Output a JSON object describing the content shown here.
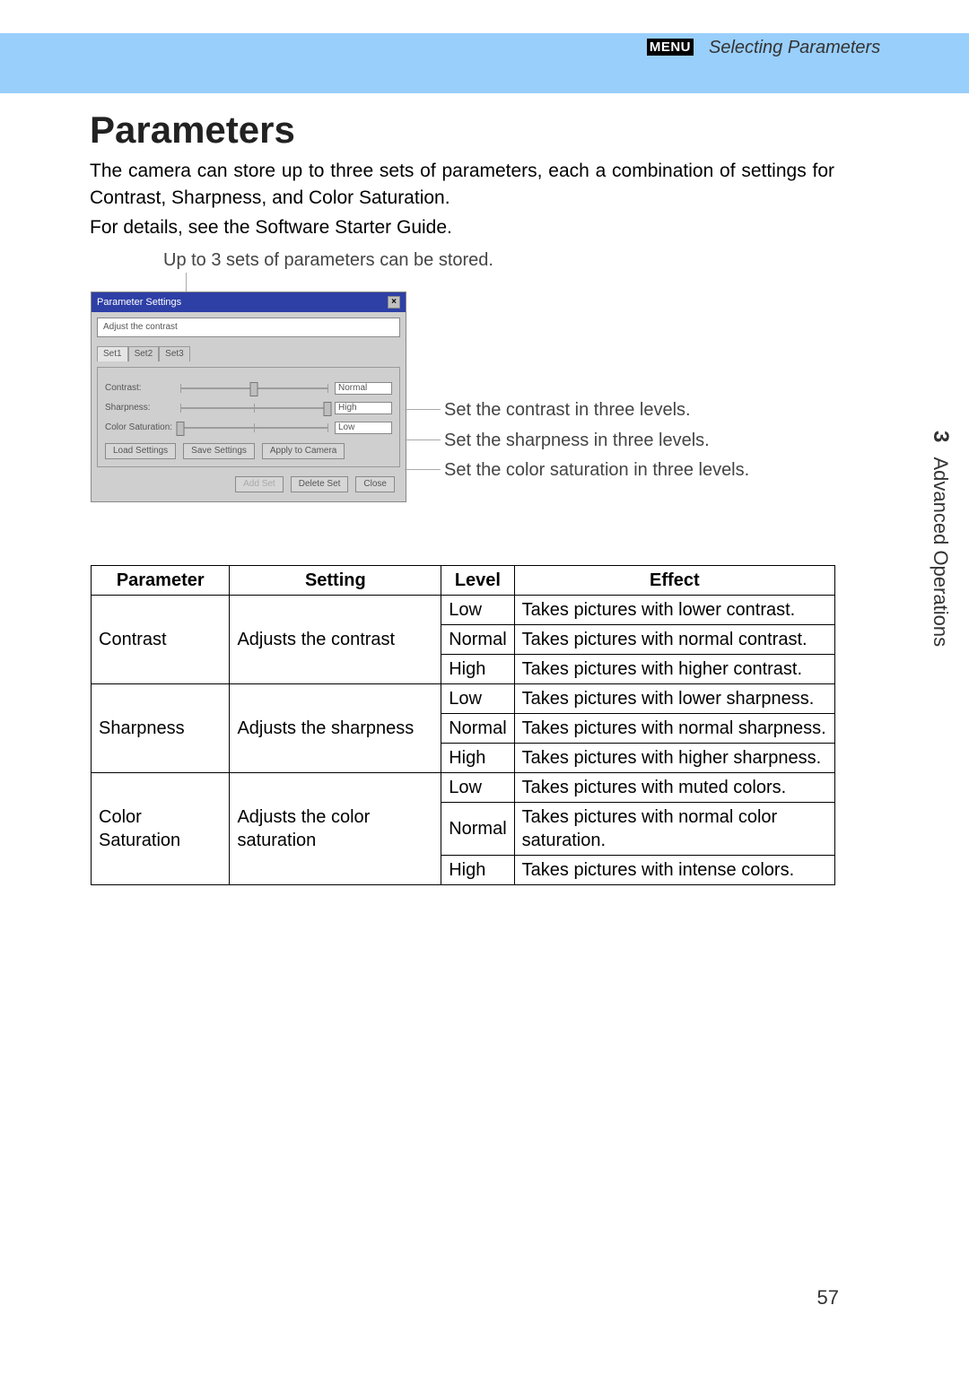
{
  "header": {
    "menu_badge": "MENU",
    "section": "Selecting Parameters"
  },
  "title": "Parameters",
  "intro1": "The camera can store up to three sets of parameters, each a combination of settings for Contrast, Sharpness, and Color Saturation.",
  "intro2": "For details, see the Software Starter Guide.",
  "caption_top": "Up to 3 sets of parameters can be stored.",
  "dialog": {
    "title": "Parameter Settings",
    "tip": "Adjust the contrast",
    "tabs": [
      "Set1",
      "Set2",
      "Set3"
    ],
    "rows": [
      {
        "label": "Contrast:",
        "value": "Normal",
        "pos": 50
      },
      {
        "label": "Sharpness:",
        "value": "High",
        "pos": 100
      },
      {
        "label": "Color Saturation:",
        "value": "Low",
        "pos": 0
      }
    ],
    "buttons_top": [
      "Load Settings",
      "Save Settings",
      "Apply to Camera"
    ],
    "buttons_bottom": [
      "Add Set",
      "Delete Set",
      "Close"
    ]
  },
  "callouts": {
    "contrast": "Set the contrast in three levels.",
    "sharpness": "Set the sharpness in three levels.",
    "saturation": "Set the color saturation in three levels."
  },
  "table": {
    "headers": [
      "Parameter",
      "Setting",
      "Level",
      "Effect"
    ],
    "groups": [
      {
        "param": "Contrast",
        "setting": "Adjusts the contrast",
        "rows": [
          {
            "level": "Low",
            "effect": "Takes pictures with lower contrast."
          },
          {
            "level": "Normal",
            "effect": "Takes pictures with normal contrast."
          },
          {
            "level": "High",
            "effect": "Takes pictures with higher contrast."
          }
        ]
      },
      {
        "param": "Sharpness",
        "setting": "Adjusts the sharpness",
        "rows": [
          {
            "level": "Low",
            "effect": "Takes pictures with lower sharpness."
          },
          {
            "level": "Normal",
            "effect": "Takes pictures with normal sharpness."
          },
          {
            "level": "High",
            "effect": "Takes pictures with higher sharpness."
          }
        ]
      },
      {
        "param": "Color Saturation",
        "setting": "Adjusts the color saturation",
        "rows": [
          {
            "level": "Low",
            "effect": "Takes pictures with muted colors."
          },
          {
            "level": "Normal",
            "effect": "Takes pictures with normal color saturation."
          },
          {
            "level": "High",
            "effect": "Takes pictures with intense colors."
          }
        ]
      }
    ]
  },
  "side_tab": {
    "num": "3",
    "label": "Advanced Operations"
  },
  "page_number": "57"
}
